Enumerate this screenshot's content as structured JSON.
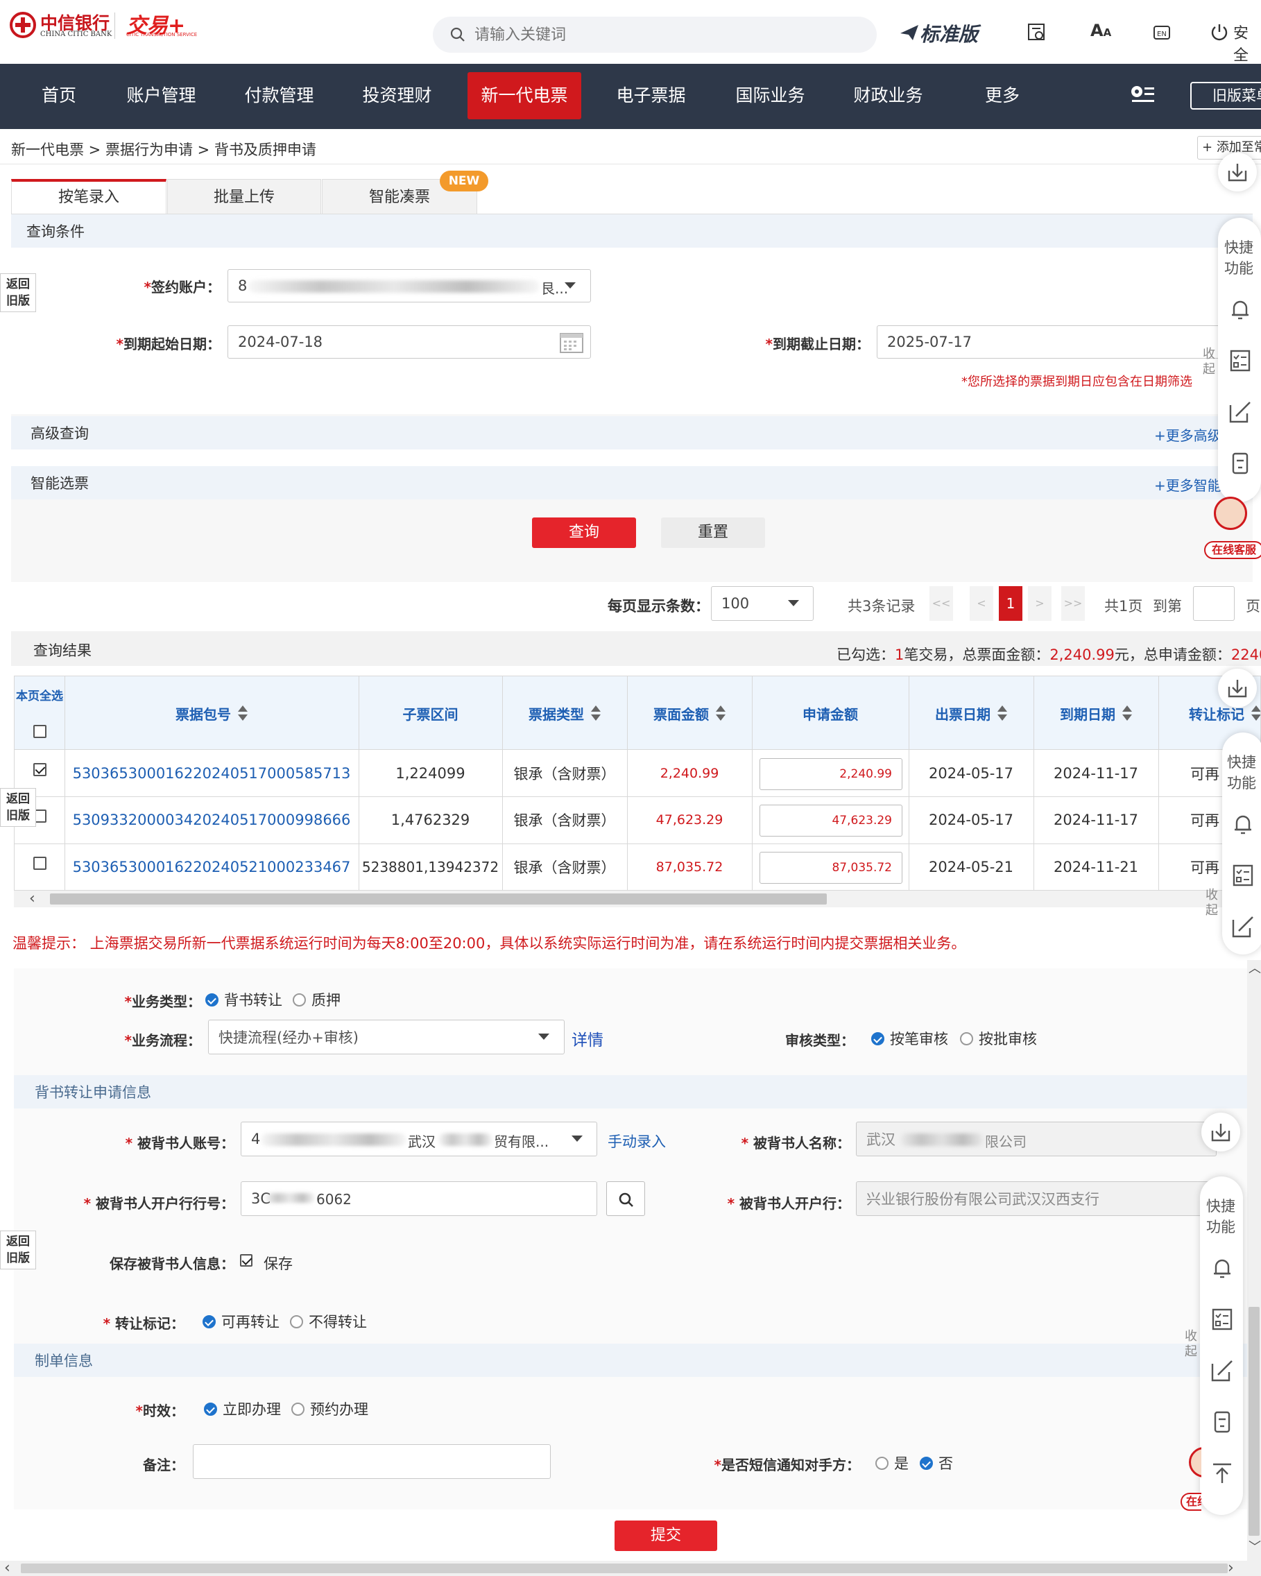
{
  "header": {
    "bank_name_cn": "中信银行",
    "bank_name_en": "CHINA CITIC BANK",
    "jiaoyi_logo": "交易+",
    "jiaoyi_sub": "CITIC TRANSACTION SERVICE",
    "search_placeholder": "请输入关键词",
    "edition": "标准版",
    "font_size_label": "A",
    "security_label": "安全"
  },
  "nav": {
    "items": [
      {
        "label": "首页"
      },
      {
        "label": "账户管理"
      },
      {
        "label": "付款管理"
      },
      {
        "label": "投资理财"
      },
      {
        "label": "新一代电票"
      },
      {
        "label": "电子票据"
      },
      {
        "label": "国际业务"
      },
      {
        "label": "财政业务"
      },
      {
        "label": "更多"
      }
    ],
    "active_index": 4,
    "old_menu_label": "旧版菜单"
  },
  "breadcrumb": {
    "text": "新一代电票 > 票据行为申请 > 背书及质押申请",
    "add_shortcut": "添加至常用"
  },
  "tabs": {
    "items": [
      {
        "label": "按笔录入"
      },
      {
        "label": "批量上传"
      },
      {
        "label": "智能凑票"
      }
    ],
    "new_badge": "NEW"
  },
  "query": {
    "section_title": "查询条件",
    "account_label": "签约账户：",
    "account_value_start": "8",
    "account_value_end": "艮...",
    "start_date_label": "到期起始日期：",
    "start_date": "2024-07-18",
    "end_date_label": "到期截止日期：",
    "end_date": "2025-07-17",
    "hint": "*您所选择的票据到期日应包含在日期筛选",
    "advanced_label": "高级查询",
    "advanced_more": "+更多高级",
    "smart_label": "智能选票",
    "smart_more": "+更多智能",
    "search_btn": "查询",
    "reset_btn": "重置"
  },
  "pagination": {
    "per_page_label": "每页显示条数：",
    "per_page_value": "100",
    "total_records": "共3条记录",
    "first": "<<",
    "prev": "<",
    "current": "1",
    "next": ">",
    "last": ">>",
    "total_pages": "共1页",
    "goto_label": "到第",
    "page_suffix": "页"
  },
  "results": {
    "section_title": "查询结果",
    "summary_prefix": "已勾选：",
    "summary_count": "1",
    "summary_mid1": "笔交易，总票面金额：",
    "summary_amount": "2,240.99",
    "summary_mid2": "元，总申请金额：",
    "summary_apply": "2240.",
    "select_all_label": "本页全选",
    "columns": [
      "票据包号",
      "子票区间",
      "票据类型",
      "票面金额",
      "申请金额",
      "出票日期",
      "到期日期",
      "转让标记"
    ],
    "rows": [
      {
        "checked": true,
        "bill_no": "530365300016220240517000585713",
        "range": "1,224099",
        "type": "银承（含财票）",
        "amount": "2,240.99",
        "apply": "2,240.99",
        "issue_date": "2024-05-17",
        "due_date": "2024-11-17",
        "transfer": "可再"
      },
      {
        "checked": false,
        "bill_no": "530933200003420240517000998666",
        "range": "1,4762329",
        "type": "银承（含财票）",
        "amount": "47,623.29",
        "apply": "47,623.29",
        "issue_date": "2024-05-17",
        "due_date": "2024-11-17",
        "transfer": "可再"
      },
      {
        "checked": false,
        "bill_no": "530365300016220240521000233467",
        "range": "5238801,13942372",
        "type": "银承（含财票）",
        "amount": "87,035.72",
        "apply": "87,035.72",
        "issue_date": "2024-05-21",
        "due_date": "2024-11-21",
        "transfer": "可再"
      }
    ]
  },
  "notice": "温馨提示：  上海票据交易所新一代票据系统运行时间为每天8:00至20:00，具体以系统实际运行时间为准，请在系统运行时间内提交票据相关业务。",
  "business": {
    "type_label": "业务类型：",
    "type_opt1": "背书转让",
    "type_opt2": "质押",
    "flow_label": "业务流程：",
    "flow_value": "快捷流程(经办+审核)",
    "flow_detail": "详情",
    "review_label": "审核类型：",
    "review_opt1": "按笔审核",
    "review_opt2": "按批审核"
  },
  "endorse": {
    "section_title": "背书转让申请信息",
    "account_label": "被背书人账号：",
    "account_start": "4",
    "account_mid": "武汉",
    "account_end": "贸有限...",
    "manual_entry": "手动录入",
    "name_label": "被背书人名称：",
    "name_start": "武汉",
    "name_end": "限公司",
    "bank_no_label": "被背书人开户行行号：",
    "bank_no_start": "3C",
    "bank_no_end": "6062",
    "bank_label": "被背书人开户行：",
    "bank_value": "兴业银行股份有限公司武汉汉西支行",
    "save_label": "保存被背书人信息：",
    "save_opt": "保存",
    "transfer_label": "转让标记：",
    "transfer_opt1": "可再转让",
    "transfer_opt2": "不得转让"
  },
  "making": {
    "section_title": "制单信息",
    "time_label": "时效：",
    "time_opt1": "立即办理",
    "time_opt2": "预约办理",
    "remark_label": "备注：",
    "sms_label": "是否短信通知对手方：",
    "sms_yes": "是",
    "sms_no": "否",
    "submit_btn": "提交"
  },
  "side": {
    "quick_label": "快捷功能",
    "collapse_label": "收起",
    "old_version_label": "返回旧版",
    "online_service": "在线客服"
  },
  "colors": {
    "nav_bg": "#2e3849",
    "accent_red": "#d0191d",
    "link_blue": "#1e5fb3",
    "radio_blue": "#1e73cc",
    "section_bg": "#eef3f9"
  }
}
